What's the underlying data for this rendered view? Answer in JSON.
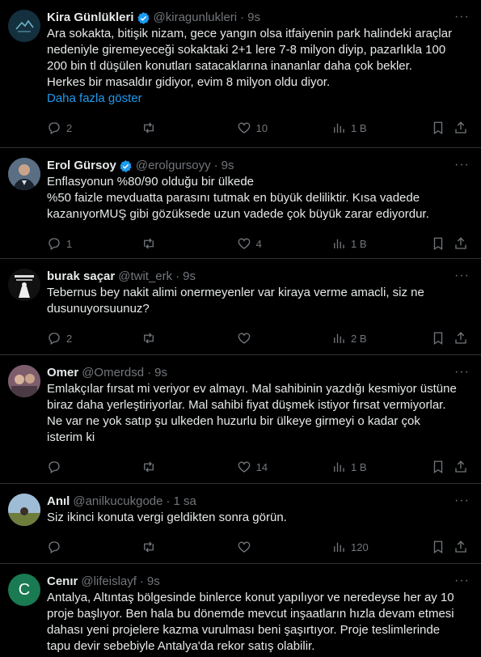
{
  "colors": {
    "accent": "#1d9bf0",
    "muted": "#71767b",
    "text": "#e7e9ea",
    "border": "#2f3336"
  },
  "tweets": [
    {
      "name": "Kira Günlükleri",
      "verified": true,
      "handle": "@kiragunlukleri",
      "time": "9s",
      "body": "Ara sokakta, bitişik nizam, gece yangın olsa itfaiyenin park halindeki araçlar\nnedeniyle giremeyeceği sokaktaki 2+1 lere 7-8 milyon diyip, pazarlıkla 100\n200 bin tl düşülen konutları satacaklarına inananlar daha çok bekler.\nHerkes bir masaldır gidiyor, evim 8 milyon oldu diyor.",
      "show_more": "Daha fazla göster",
      "replies": "2",
      "retweets": "",
      "likes": "10",
      "views": "1 B"
    },
    {
      "name": "Erol Gürsoy",
      "verified": true,
      "handle": "@erolgursoyy",
      "time": "9s",
      "body": "Enflasyonun %80/90 olduğu bir ülkede\n%50 faizle mevduatta parasını tutmak en büyük deliliktir. Kısa vadede\nkazanıyorMUŞ gibi gözüksede uzun vadede çok büyük zarar ediyordur.",
      "replies": "1",
      "retweets": "",
      "likes": "4",
      "views": "1 B"
    },
    {
      "name": "burak saçar",
      "verified": false,
      "handle": "@twit_erk",
      "time": "9s",
      "body": "Tebernus bey nakit alimi onermeyenler var kiraya verme amacli, siz ne\ndusunuyorsuunuz?",
      "replies": "2",
      "retweets": "",
      "likes": "",
      "views": "2 B"
    },
    {
      "name": "Omer",
      "verified": false,
      "handle": "@Omerdsd",
      "time": "9s",
      "body": "Emlakçılar fırsat mi veriyor ev almayı. Mal sahibinin yazdığı kesmiyor üstüne\nbiraz daha yerleştiriyorlar. Mal sahibi fiyat düşmek istiyor fırsat vermiyorlar.\nNe var ne yok satıp şu ulkeden huzurlu bir ülkeye girmeyi o kadar çok\nisterim ki",
      "replies": "",
      "retweets": "",
      "likes": "14",
      "views": "1 B"
    },
    {
      "name": "Anıl",
      "verified": false,
      "handle": "@anilkucukgode",
      "time": "1 sa",
      "body": "Siz ikinci konuta vergi geldikten sonra görün.",
      "replies": "",
      "retweets": "",
      "likes": "",
      "views": "120"
    },
    {
      "name": "Cenır",
      "verified": false,
      "handle": "@lifeislayf",
      "time": "9s",
      "avatar_letter": "C",
      "body": "Antalya, Altıntaş bölgesinde binlerce konut yapılıyor ve neredeyse her ay 10\nproje başlıyor. Ben hala bu dönemde mevcut inşaatların hızla devam etmesi\ndahası yeni projelere kazma vurulması beni şaşırtıyor. Proje teslimlerinde\ntapu devir sebebiyle Antalya'da rekor satış olabilir."
    }
  ]
}
